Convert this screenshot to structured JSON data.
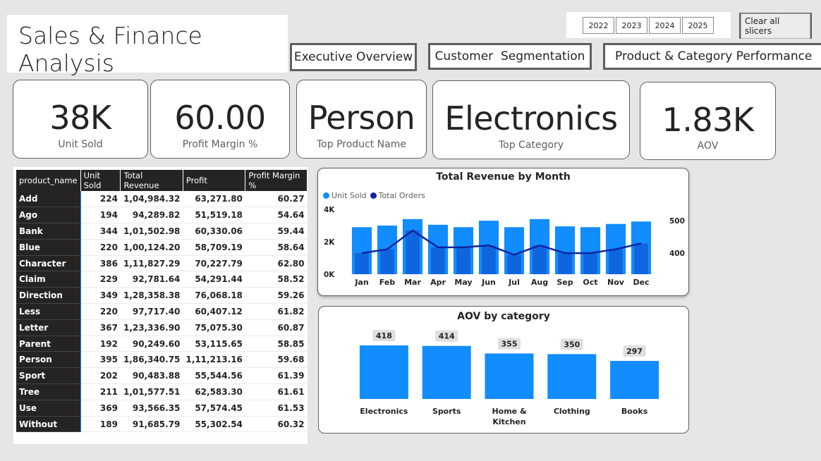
{
  "header": {
    "title": "Sales & Finance Analysis",
    "nav": [
      "Executive Overview",
      "Customer  Segmentation",
      "Product & Category Performance"
    ],
    "years": [
      "2022",
      "2023",
      "2024",
      "2025"
    ],
    "clear_label": "Clear all slicers"
  },
  "kpis": [
    {
      "value": "38K",
      "label": "Unit Sold"
    },
    {
      "value": "60.00",
      "label": "Profit Margin %"
    },
    {
      "value": "Person",
      "label": "Top Product Name"
    },
    {
      "value": "Electronics",
      "label": "Top Category"
    },
    {
      "value": "1.83K",
      "label": "AOV"
    }
  ],
  "table": {
    "headers": [
      "product_name",
      "Unit Sold",
      "Total Revenue",
      "Profit",
      "Profit Margin %"
    ],
    "rows": [
      [
        "Add",
        "224",
        "1,04,984.32",
        "63,271.80",
        "60.27"
      ],
      [
        "Ago",
        "194",
        "94,289.82",
        "51,519.18",
        "54.64"
      ],
      [
        "Bank",
        "344",
        "1,01,502.98",
        "60,330.06",
        "59.44"
      ],
      [
        "Blue",
        "220",
        "1,00,124.20",
        "58,709.19",
        "58.64"
      ],
      [
        "Character",
        "386",
        "1,11,827.29",
        "70,227.79",
        "62.80"
      ],
      [
        "Claim",
        "229",
        "92,781.64",
        "54,291.44",
        "58.52"
      ],
      [
        "Direction",
        "349",
        "1,28,358.38",
        "76,068.18",
        "59.26"
      ],
      [
        "Less",
        "220",
        "97,717.40",
        "60,407.12",
        "61.82"
      ],
      [
        "Letter",
        "367",
        "1,23,336.90",
        "75,075.30",
        "60.87"
      ],
      [
        "Parent",
        "192",
        "90,249.60",
        "53,115.65",
        "58.85"
      ],
      [
        "Person",
        "395",
        "1,86,340.75",
        "1,11,213.16",
        "59.68"
      ],
      [
        "Sport",
        "202",
        "90,483.88",
        "55,544.56",
        "61.39"
      ],
      [
        "Tree",
        "211",
        "1,01,577.51",
        "62,583.30",
        "61.61"
      ],
      [
        "Use",
        "369",
        "93,566.35",
        "57,574.45",
        "61.53"
      ],
      [
        "Without",
        "189",
        "91,685.79",
        "55,302.54",
        "60.32"
      ]
    ]
  },
  "colors": {
    "bar_primary": "#118dff",
    "bar_secondary": "#0f5ed7",
    "line": "#12239e",
    "dark_header": "#252423",
    "background": "#e6e6e6"
  },
  "chart_data": [
    {
      "type": "bar",
      "title": "Total Revenue by Month",
      "categories": [
        "Jan",
        "Feb",
        "Mar",
        "Apr",
        "May",
        "Jun",
        "Jul",
        "Aug",
        "Sep",
        "Oct",
        "Nov",
        "Dec"
      ],
      "legend": [
        "Unit Sold",
        "Total Orders"
      ],
      "series": [
        {
          "name": "Unit Sold",
          "values": [
            2900,
            3000,
            3400,
            3050,
            2900,
            3300,
            2900,
            3400,
            2950,
            2900,
            3100,
            3250
          ]
        },
        {
          "name": "Total Orders",
          "values": [
            400,
            412,
            470,
            418,
            418,
            424,
            395,
            424,
            400,
            400,
            412,
            430
          ]
        }
      ],
      "y_ticks_left": [
        "0K",
        "2K",
        "4K"
      ],
      "y_ticks_right": [
        "400",
        "500"
      ],
      "ylim_left": [
        0,
        4000
      ],
      "ylim_right": [
        335,
        535
      ],
      "legend_position": "top-left"
    },
    {
      "type": "bar",
      "title": "AOV by category",
      "categories": [
        "Electronics",
        "Sports",
        "Home & Kitchen",
        "Clothing",
        "Books"
      ],
      "values": [
        418,
        414,
        355,
        350,
        297
      ],
      "data_labels": [
        "418",
        "414",
        "355",
        "350",
        "297"
      ],
      "ylim": [
        0,
        550
      ]
    }
  ]
}
